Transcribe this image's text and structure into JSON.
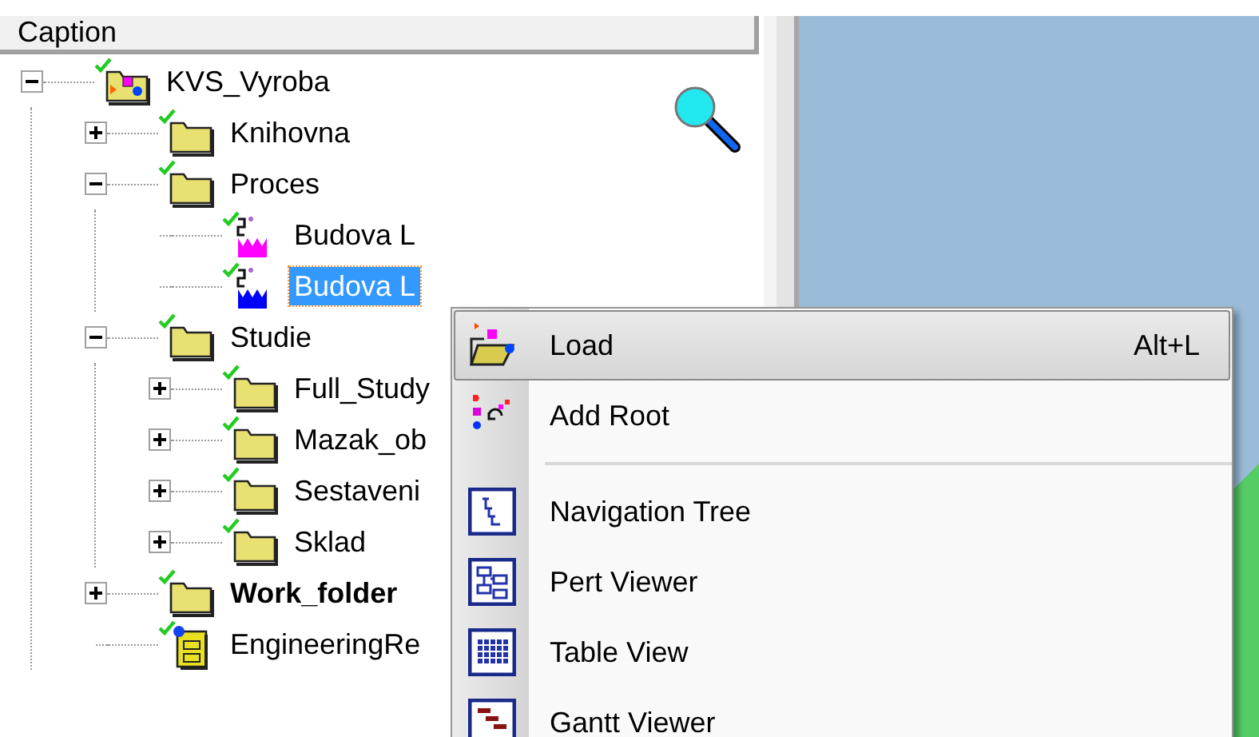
{
  "tree_panel": {
    "header": "Caption"
  },
  "tree": [
    {
      "label": "KVS_Vyroba",
      "kind": "project",
      "checked": true,
      "expanded": true,
      "selected": false,
      "bold": false,
      "children": [
        {
          "label": "Knihovna",
          "kind": "folder",
          "checked": true,
          "expanded": false,
          "selected": false,
          "bold": false
        },
        {
          "label": "Proces",
          "kind": "folder",
          "checked": true,
          "expanded": true,
          "selected": false,
          "bold": false,
          "children": [
            {
              "label": "Budova L",
              "kind": "process",
              "color": "#ff00ff",
              "checked": true,
              "selected": false,
              "bold": false
            },
            {
              "label": "Budova L",
              "kind": "process",
              "color": "#0000ff",
              "checked": true,
              "selected": true,
              "bold": false
            }
          ]
        },
        {
          "label": "Studie",
          "kind": "folder",
          "checked": true,
          "expanded": true,
          "selected": false,
          "bold": false,
          "children": [
            {
              "label": "Full_Study",
              "kind": "folder",
              "checked": true,
              "expanded": false,
              "selected": false,
              "bold": false
            },
            {
              "label": "Mazak_ob",
              "kind": "folder",
              "checked": true,
              "expanded": false,
              "selected": false,
              "bold": false
            },
            {
              "label": "Sestaveni",
              "kind": "folder",
              "checked": true,
              "expanded": false,
              "selected": false,
              "bold": false
            },
            {
              "label": "Sklad",
              "kind": "folder",
              "checked": true,
              "expanded": false,
              "selected": false,
              "bold": false
            }
          ]
        },
        {
          "label": "Work_folder",
          "kind": "folder",
          "checked": true,
          "expanded": false,
          "selected": false,
          "bold": true
        },
        {
          "label": "EngineeringRe",
          "kind": "report",
          "checked": true,
          "selected": false,
          "bold": false
        }
      ]
    }
  ],
  "context_menu": [
    {
      "kind": "load",
      "label": "Load",
      "shortcut": "Alt+L",
      "selected": true
    },
    {
      "kind": "add-root",
      "label": "Add Root",
      "selected": false
    },
    {
      "kind": "separator"
    },
    {
      "kind": "tree",
      "label": "Navigation Tree",
      "selected": false
    },
    {
      "kind": "pert",
      "label": "Pert Viewer",
      "selected": false
    },
    {
      "kind": "table",
      "label": "Table View",
      "selected": false
    },
    {
      "kind": "gantt",
      "label": "Gantt Viewer",
      "selected": false
    }
  ]
}
